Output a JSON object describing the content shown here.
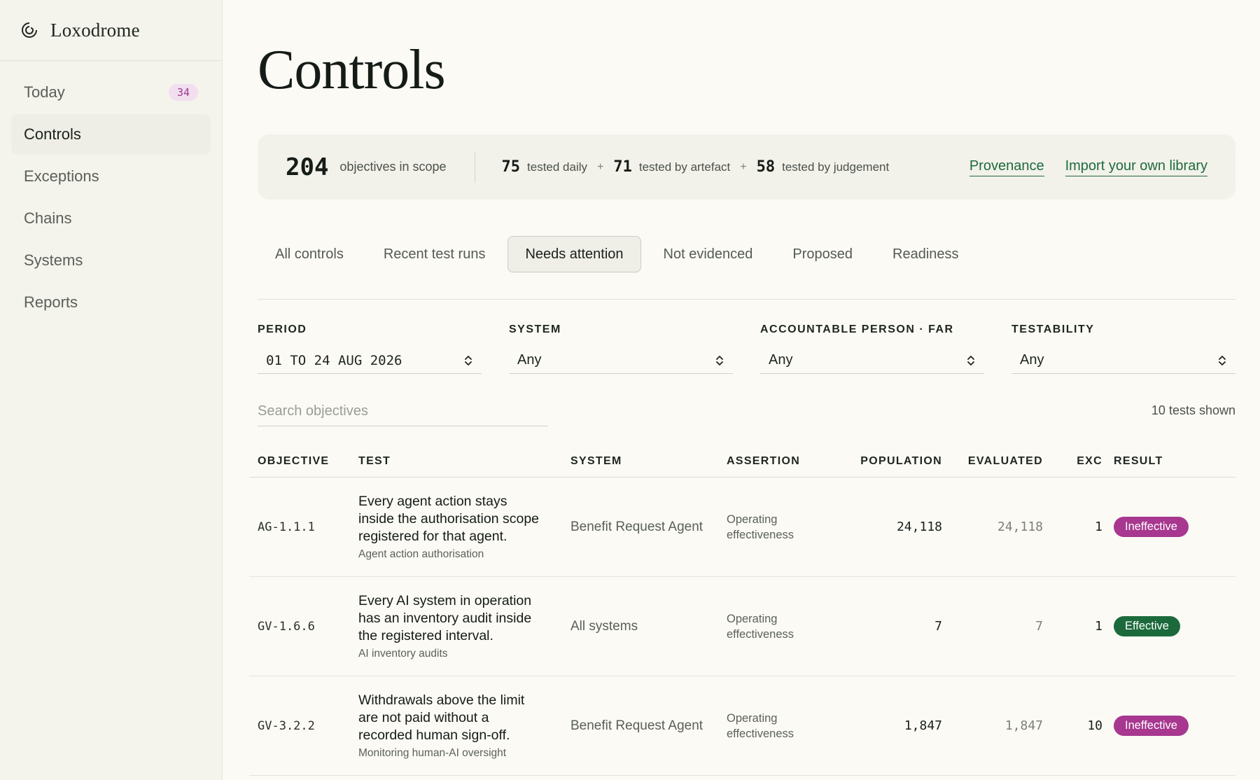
{
  "brand": {
    "name": "Loxodrome"
  },
  "sidebar": {
    "items": [
      {
        "label": "Today",
        "badge": "34"
      },
      {
        "label": "Controls"
      },
      {
        "label": "Exceptions"
      },
      {
        "label": "Chains"
      },
      {
        "label": "Systems"
      },
      {
        "label": "Reports"
      }
    ],
    "active": "Controls"
  },
  "page": {
    "title": "Controls"
  },
  "summary": {
    "objectives_count": "204",
    "objectives_label": "objectives in scope",
    "daily_count": "75",
    "daily_label": "tested daily",
    "artefact_count": "71",
    "artefact_label": "tested by artefact",
    "judgement_count": "58",
    "judgement_label": "tested by judgement",
    "plus": "+",
    "link_provenance": "Provenance",
    "link_import": "Import your own library"
  },
  "tabs": [
    {
      "label": "All controls"
    },
    {
      "label": "Recent test runs"
    },
    {
      "label": "Needs attention",
      "active": true
    },
    {
      "label": "Not evidenced"
    },
    {
      "label": "Proposed"
    },
    {
      "label": "Readiness"
    }
  ],
  "filters": {
    "period": {
      "label": "PERIOD",
      "value": "01 TO 24 AUG 2026"
    },
    "system": {
      "label": "SYSTEM",
      "value": "Any"
    },
    "person": {
      "label": "ACCOUNTABLE PERSON · FAR",
      "value": "Any"
    },
    "testability": {
      "label": "TESTABILITY",
      "value": "Any"
    }
  },
  "search": {
    "placeholder": "Search objectives"
  },
  "results_count": "10 tests shown",
  "table": {
    "headers": {
      "objective": "OBJECTIVE",
      "test": "TEST",
      "system": "SYSTEM",
      "assertion": "ASSERTION",
      "population": "POPULATION",
      "evaluated": "EVALUATED",
      "exc": "EXC",
      "result": "RESULT"
    },
    "rows": [
      {
        "objective": "AG-1.1.1",
        "test_line1": "Every agent action stays",
        "test_line2": "inside the authorisation scope",
        "test_line3": "registered for that agent.",
        "test_sub": "Agent action authorisation",
        "system": "Benefit Request Agent",
        "assertion_line1": "Operating",
        "assertion_line2": "effectiveness",
        "population": "24,118",
        "evaluated": "24,118",
        "exc": "1",
        "result": "Ineffective"
      },
      {
        "objective": "GV-1.6.6",
        "test_line1": "Every AI system in operation",
        "test_line2": "has an inventory audit inside",
        "test_line3": "the registered interval.",
        "test_sub": "AI inventory audits",
        "system": "All systems",
        "assertion_line1": "Operating",
        "assertion_line2": "effectiveness",
        "population": "7",
        "evaluated": "7",
        "exc": "1",
        "result": "Effective"
      },
      {
        "objective": "GV-3.2.2",
        "test_line1": "Withdrawals above the limit",
        "test_line2": "are not paid without a",
        "test_line3": "recorded human sign-off.",
        "test_sub": "Monitoring human-AI oversight",
        "system": "Benefit Request Agent",
        "assertion_line1": "Operating",
        "assertion_line2": "effectiveness",
        "population": "1,847",
        "evaluated": "1,847",
        "exc": "10",
        "result": "Ineffective"
      }
    ]
  },
  "colors": {
    "accent_green": "#1d6b3d",
    "ineffective": "#a7378f",
    "effective": "#1c6a3c",
    "badge_bg": "#f1dff0"
  }
}
